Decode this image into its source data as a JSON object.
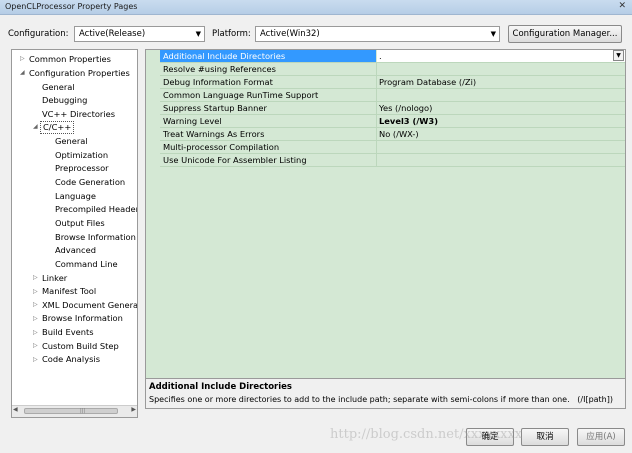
{
  "window": {
    "title": "OpenCLProcessor Property Pages",
    "close_glyph": "✕"
  },
  "toolbar": {
    "configuration_label": "Configuration:",
    "configuration_value": "Active(Release)",
    "platform_label": "Platform:",
    "platform_value": "Active(Win32)",
    "config_manager_label": "Configuration Manager..."
  },
  "tree": {
    "items": [
      {
        "label": "Common Properties",
        "expander": "▷"
      },
      {
        "label": "Configuration Properties",
        "expander": "◢"
      },
      {
        "label": "General"
      },
      {
        "label": "Debugging"
      },
      {
        "label": "VC++ Directories"
      },
      {
        "label": "C/C++",
        "expander": "◢"
      },
      {
        "label": "General"
      },
      {
        "label": "Optimization"
      },
      {
        "label": "Preprocessor"
      },
      {
        "label": "Code Generation"
      },
      {
        "label": "Language"
      },
      {
        "label": "Precompiled Header"
      },
      {
        "label": "Output Files"
      },
      {
        "label": "Browse Information"
      },
      {
        "label": "Advanced"
      },
      {
        "label": "Command Line"
      },
      {
        "label": "Linker",
        "expander": "▷"
      },
      {
        "label": "Manifest Tool",
        "expander": "▷"
      },
      {
        "label": "XML Document Generat",
        "expander": "▷"
      },
      {
        "label": "Browse Information",
        "expander": "▷"
      },
      {
        "label": "Build Events",
        "expander": "▷"
      },
      {
        "label": "Custom Build Step",
        "expander": "▷"
      },
      {
        "label": "Code Analysis",
        "expander": "▷"
      }
    ]
  },
  "grid": {
    "rows": [
      {
        "name": "Additional Include Directories",
        "value": "."
      },
      {
        "name": "Resolve #using References",
        "value": ""
      },
      {
        "name": "Debug Information Format",
        "value": "Program Database (/Zi)"
      },
      {
        "name": "Common Language RunTime Support",
        "value": ""
      },
      {
        "name": "Suppress Startup Banner",
        "value": "Yes (/nologo)"
      },
      {
        "name": "Warning Level",
        "value": "Level3 (/W3)"
      },
      {
        "name": "Treat Warnings As Errors",
        "value": "No (/WX-)"
      },
      {
        "name": "Multi-processor Compilation",
        "value": ""
      },
      {
        "name": "Use Unicode For Assembler Listing",
        "value": ""
      }
    ]
  },
  "description": {
    "title": "Additional Include Directories",
    "text": "Specifies one or more directories to add to the include path; separate with semi-colons if more than one.",
    "switch": "(/I[path])"
  },
  "buttons": {
    "ok": "确定",
    "cancel": "取消",
    "apply": "应用(A)"
  },
  "watermark": "http://blog.csdn.net/xxxxxxxx"
}
